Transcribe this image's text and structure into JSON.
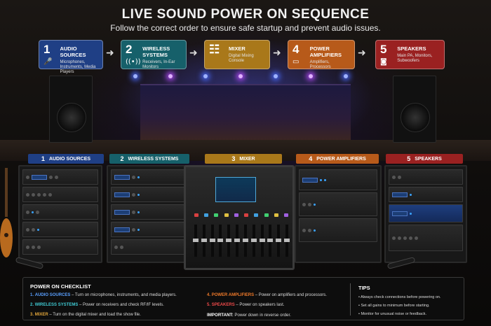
{
  "title": "LIVE SOUND POWER ON SEQUENCE",
  "subtitle": "Follow the correct order to ensure safe startup and prevent audio issues.",
  "steps": [
    {
      "num": "1",
      "name": "AUDIO SOURCES",
      "desc": "Microphones, Instruments, Media Players",
      "color": "#1f3f85",
      "icon": "mic-icon"
    },
    {
      "num": "2",
      "name": "WIRELESS SYSTEMS",
      "desc": "Receivers, In-Ear Monitors",
      "color": "#16606a",
      "icon": "wireless-icon"
    },
    {
      "num": "3",
      "name": "MIXER",
      "desc": "Digital Mixing Console",
      "color": "#a9781a",
      "icon": "sliders-icon"
    },
    {
      "num": "4",
      "name": "POWER AMPLIFIERS",
      "desc": "Amplifiers, Processors",
      "color": "#b75a1a",
      "icon": "amplifier-icon"
    },
    {
      "num": "5",
      "name": "SPEAKERS",
      "desc": "Main PA, Monitors, Subwoofers",
      "color": "#9a2121",
      "icon": "speaker-icon"
    }
  ],
  "rack_labels": [
    {
      "num": "1",
      "name": "AUDIO SOURCES",
      "color": "#1f3f85"
    },
    {
      "num": "2",
      "name": "WIRELESS SYSTEMS",
      "color": "#16606a"
    },
    {
      "num": "3",
      "name": "MIXER",
      "color": "#a9781a"
    },
    {
      "num": "4",
      "name": "POWER AMPLIFIERS",
      "color": "#b75a1a"
    },
    {
      "num": "5",
      "name": "SPEAKERS",
      "color": "#9a2121"
    }
  ],
  "checklist": {
    "title": "POWER ON CHECKLIST",
    "items": [
      {
        "num": "1.",
        "name": "AUDIO SOURCES",
        "text": " – Turn on microphones, instruments, and media players.",
        "color": "#5aa0ff"
      },
      {
        "num": "2.",
        "name": "WIRELESS SYSTEMS",
        "text": " – Power on receivers and check RF/IF levels.",
        "color": "#3fc9d2"
      },
      {
        "num": "3.",
        "name": "MIXER",
        "text": " – Turn on the digital mixer and load the show file.",
        "color": "#e0a53a"
      },
      {
        "num": "4.",
        "name": "POWER AMPLIFIERS",
        "text": " – Power on amplifiers and processors.",
        "color": "#f07a2a"
      },
      {
        "num": "5.",
        "name": "SPEAKERS",
        "text": " – Power on speakers last.",
        "color": "#ef4a4a"
      }
    ],
    "important_label": "IMPORTANT:",
    "important_text": " Power down in reverse order."
  },
  "tips": {
    "title": "TIPS",
    "items": [
      "• Always check connections before powering on.",
      "• Set all gains to minimum before starting.",
      "• Monitor for unusual noise or feedback."
    ]
  }
}
